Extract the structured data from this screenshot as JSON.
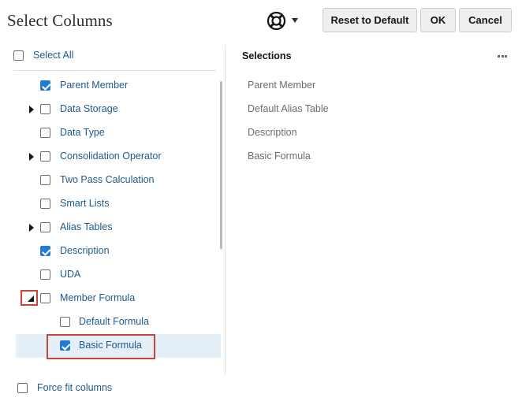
{
  "header": {
    "title": "Select Columns",
    "help_icon": "lifebuoy-icon",
    "reset_label": "Reset to Default",
    "ok_label": "OK",
    "cancel_label": "Cancel"
  },
  "left": {
    "select_all_label": "Select All",
    "select_all_checked": false,
    "tree": [
      {
        "label": "Parent Member",
        "checked": true,
        "expander": "none"
      },
      {
        "label": "Data Storage",
        "checked": false,
        "expander": "collapsed"
      },
      {
        "label": "Data Type",
        "checked": false,
        "expander": "none"
      },
      {
        "label": "Consolidation Operator",
        "checked": false,
        "expander": "collapsed"
      },
      {
        "label": "Two Pass Calculation",
        "checked": false,
        "expander": "none"
      },
      {
        "label": "Smart Lists",
        "checked": false,
        "expander": "none"
      },
      {
        "label": "Alias Tables",
        "checked": false,
        "expander": "collapsed"
      },
      {
        "label": "Description",
        "checked": true,
        "expander": "none"
      },
      {
        "label": "UDA",
        "checked": false,
        "expander": "none"
      },
      {
        "label": "Member Formula",
        "checked": false,
        "expander": "expanded"
      },
      {
        "label": "Default Formula",
        "checked": false,
        "expander": "none",
        "child": true
      },
      {
        "label": "Basic Formula",
        "checked": true,
        "expander": "none",
        "child": true,
        "selected": true
      }
    ],
    "force_fit_label": "Force fit columns",
    "force_fit_checked": false
  },
  "right": {
    "title": "Selections",
    "more_icon": "more-horizontal-icon",
    "items": [
      "Parent Member",
      "Default Alias Table",
      "Description",
      "Basic Formula"
    ]
  },
  "colors": {
    "link": "#1f5a8c",
    "checkbox_checked": "#227ad5",
    "annotation_red": "#c74634",
    "selected_row": "#e4eff7"
  }
}
